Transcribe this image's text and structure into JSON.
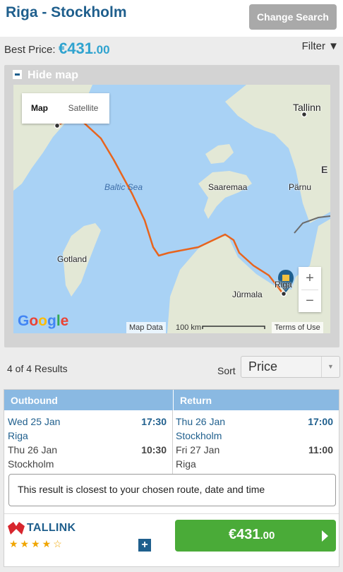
{
  "header": {
    "title": "Riga - Stockholm",
    "change_search": "Change Search"
  },
  "price_bar": {
    "best_label": "Best Price:",
    "best_whole": "€431",
    "best_cents": ".00",
    "filter": "Filter ▼"
  },
  "map_panel": {
    "toggle_label": "Hide map",
    "tabs": [
      "Map",
      "Satellite"
    ],
    "places": {
      "tallinn": "Tallinn",
      "baltic_sea": "Baltic Sea",
      "saaremaa": "Saaremaa",
      "parnu": "Pärnu",
      "gotland": "Gotland",
      "jurmala": "Jūrmala",
      "riga": "Riga",
      "edge_letter": "E"
    },
    "google_logo": "Google",
    "map_data": "Map Data",
    "scale": "100 km",
    "terms": "Terms of Use",
    "zoom_in": "+",
    "zoom_out": "−",
    "colors": {
      "route": "#e8641d",
      "water": "#a9d2f5",
      "land": "#e8eadb"
    }
  },
  "results": {
    "count": "4 of 4 Results",
    "sort_label": "Sort",
    "sort_value": "Price"
  },
  "card": {
    "outbound_header": "Outbound",
    "return_header": "Return",
    "outbound": {
      "depart_date": "Wed 25 Jan",
      "depart_time": "17:30",
      "depart_port": "Riga",
      "arrive_date": "Thu 26 Jan",
      "arrive_time": "10:30",
      "arrive_port": "Stockholm"
    },
    "return": {
      "depart_date": "Thu 26 Jan",
      "depart_time": "17:00",
      "depart_port": "Stockholm",
      "arrive_date": "Fri 27 Jan",
      "arrive_time": "11:00",
      "arrive_port": "Riga"
    },
    "note": "This result is closest to your chosen route, date and time",
    "operator": "TALLINK",
    "rating": {
      "value": 4,
      "max": 5,
      "display": "★★★★☆"
    },
    "more": "+",
    "price_whole": "€431",
    "price_cents": ".00",
    "accent_color": "#4aab38"
  }
}
